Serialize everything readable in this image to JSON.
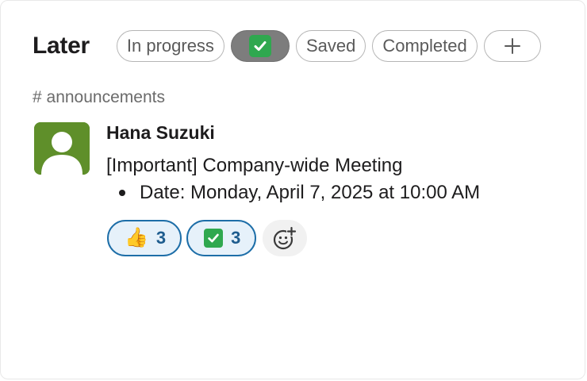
{
  "header": {
    "title": "Later",
    "filters": [
      {
        "label": "In progress",
        "active": false
      },
      {
        "label": "",
        "icon": "check-box-emoji-icon",
        "active": true
      },
      {
        "label": "Saved",
        "active": false
      },
      {
        "label": "Completed",
        "active": false
      },
      {
        "label": "+",
        "icon": "plus-icon",
        "active": false
      }
    ]
  },
  "item": {
    "channel": "# announcements",
    "sender": "Hana Suzuki",
    "message": "[Important] Company-wide Meeting",
    "bullets": [
      "Date: Monday, April 7, 2025 at 10:00 AM"
    ],
    "reactions": [
      {
        "emoji": "👍",
        "icon": "thumbs-up-emoji-icon",
        "count": "3"
      },
      {
        "emoji": "",
        "icon": "check-box-emoji-icon",
        "count": "3"
      }
    ]
  },
  "colors": {
    "avatar_bg": "#5f8f2a",
    "check_green": "#2fa84f",
    "reaction_border": "#1d6ea8",
    "reaction_bg": "#e6f1fa",
    "active_filter": "#7d7d7d"
  }
}
